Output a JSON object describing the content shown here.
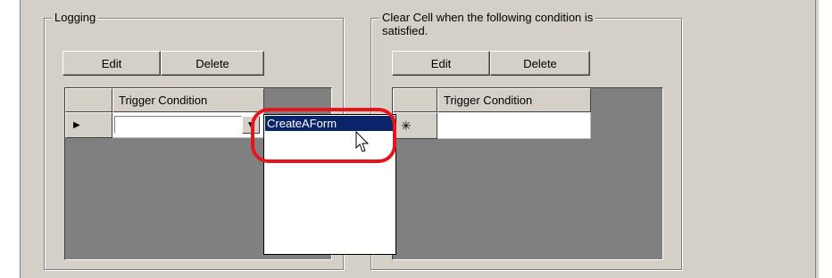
{
  "logging": {
    "legend": "Logging",
    "edit_label": "Edit",
    "delete_label": "Delete",
    "column_header": "Trigger Condition",
    "row_marker": "▶",
    "cell_value": "",
    "combo_arrow": "▼"
  },
  "clear_cell": {
    "legend_line1": "Clear Cell when the following condition is",
    "legend_line2": "satisfied.",
    "edit_label": "Edit",
    "delete_label": "Delete",
    "column_header": "Trigger Condition",
    "new_row_marker": "✳"
  },
  "dropdown": {
    "options": [
      "CreateAForm"
    ],
    "selected": "CreateAForm"
  },
  "colors": {
    "dialog_bg": "#d4d0c8",
    "selection": "#0a246a",
    "highlight_ring": "#e8141c"
  }
}
